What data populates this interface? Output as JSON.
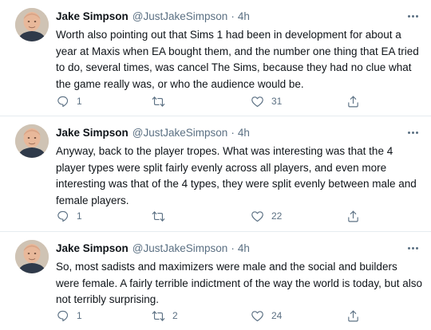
{
  "tweets": [
    {
      "author_name": "Jake Simpson",
      "handle": "@JustJakeSimpson",
      "separator": "·",
      "time": "4h",
      "text": "Worth also pointing out that Sims 1 had been in development for about a year at Maxis when EA bought them, and the number one thing that EA tried to do, several times, was cancel The Sims, because they had no clue what the game really was, or who the audience would be.",
      "reply_count": "1",
      "retweet_count": "",
      "like_count": "31"
    },
    {
      "author_name": "Jake Simpson",
      "handle": "@JustJakeSimpson",
      "separator": "·",
      "time": "4h",
      "text": "Anyway, back to the player tropes. What was interesting was that the 4 player types were split fairly evenly across all players, and even more interesting was that of the 4 types, they were split evenly between male and female players.",
      "reply_count": "1",
      "retweet_count": "",
      "like_count": "22"
    },
    {
      "author_name": "Jake Simpson",
      "handle": "@JustJakeSimpson",
      "separator": "·",
      "time": "4h",
      "text": "So, most sadists and maximizers were male and the social and builders were female. A fairly terrible indictment of the way the world is today, but also not terribly surprising.",
      "reply_count": "1",
      "retweet_count": "2",
      "like_count": "24"
    }
  ],
  "icons": {
    "more": "more-horizontal-icon",
    "reply": "reply-icon",
    "retweet": "retweet-icon",
    "like": "heart-icon",
    "share": "share-icon"
  },
  "colors": {
    "text": "#0f1419",
    "secondary": "#5b7083",
    "divider": "#e6ecf0"
  }
}
